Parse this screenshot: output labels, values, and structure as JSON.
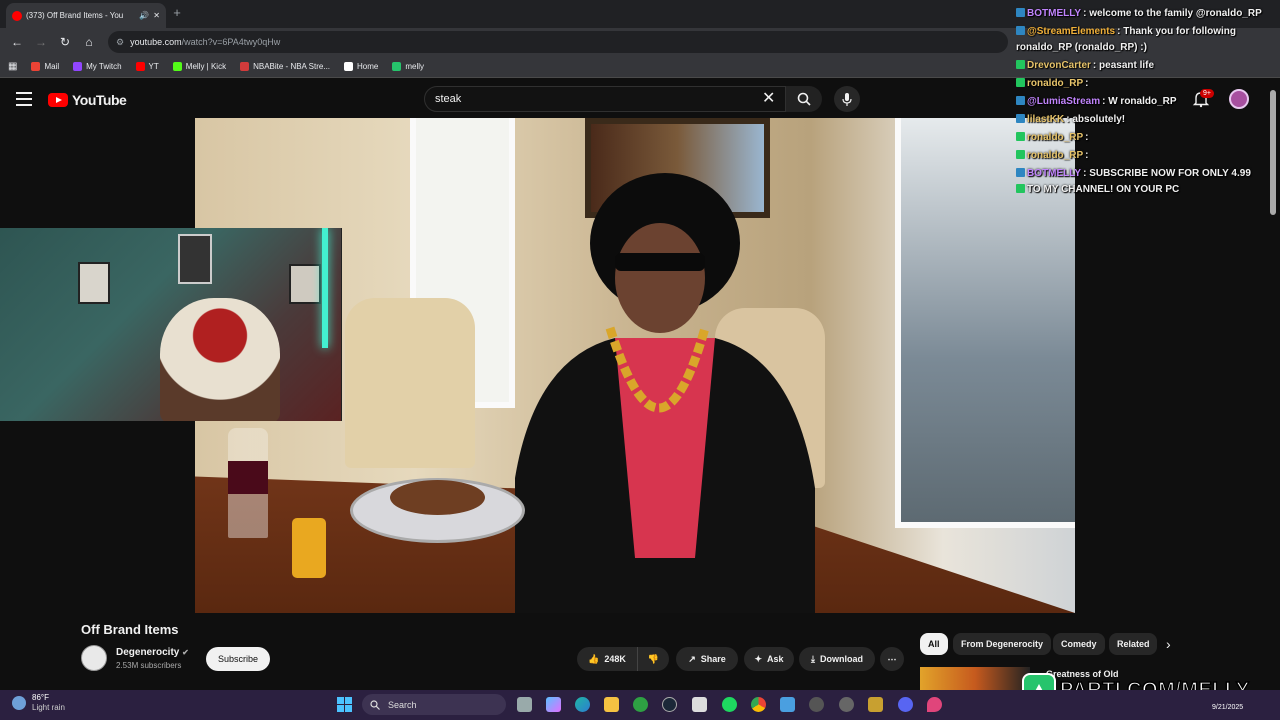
{
  "browser": {
    "tab_title": "(373) Off Brand Items - You",
    "url_host": "youtube.com",
    "url_path": "/watch?v=6PA4twy0qHw",
    "new_tab_glyph": "+",
    "bookmarks": [
      {
        "label": "Mail",
        "color": "#ea4335"
      },
      {
        "label": "My Twitch",
        "color": "#9146ff"
      },
      {
        "label": "YT",
        "color": "#ff0000"
      },
      {
        "label": "Melly | Kick",
        "color": "#53fc18"
      },
      {
        "label": "NBABite - NBA Stre...",
        "color": "#d23b3b"
      },
      {
        "label": "Home",
        "color": "#ffffff"
      },
      {
        "label": "melly",
        "color": "#26c46c"
      }
    ]
  },
  "youtube": {
    "logo_text": "YouTube",
    "search_query": "steak",
    "notification_count": "9+",
    "video_title": "Off Brand Items",
    "channel_name": "Degenerocity",
    "subscribers": "2.53M subscribers",
    "subscribe_label": "Subscribe",
    "actions": {
      "likes": "248K",
      "share": "Share",
      "ask": "Ask",
      "download": "Download"
    },
    "chips": [
      "All",
      "From Degenerocity",
      "Comedy",
      "Related"
    ],
    "next_video_title": "Greatness of Old"
  },
  "chat": [
    {
      "badge": "#2e86c1",
      "user": "BOTMELLY",
      "user_color": "#c084fc",
      "msg": "welcome to the family @ronaldo_RP"
    },
    {
      "badge": "#2e86c1",
      "user": "@StreamElements",
      "user_color": "#f0b03a",
      "msg": "Thank you for following"
    },
    {
      "badge": "",
      "user": "",
      "user_color": "#ffffff",
      "msg": "ronaldo_RP (ronaldo_RP) :)"
    },
    {
      "badge": "#22c55e",
      "user": "DrevonCarter",
      "user_color": "#e6c36a",
      "msg": "peasant life"
    },
    {
      "badge": "#22c55e",
      "user": "ronaldo_RP",
      "user_color": "#e6c36a",
      "msg": ""
    },
    {
      "badge": "#2e86c1",
      "user": "@LumiaStream",
      "user_color": "#c084fc",
      "msg": "W ronaldo_RP"
    },
    {
      "badge": "#2e86c1",
      "user": "lilastKK",
      "user_color": "#e6c36a",
      "msg": "absolutely!"
    },
    {
      "badge": "#22c55e",
      "user": "ronaldo_RP",
      "user_color": "#e6c36a",
      "msg": ""
    },
    {
      "badge": "#22c55e",
      "user": "ronaldo_RP",
      "user_color": "#e6c36a",
      "msg": ""
    },
    {
      "badge": "#2e86c1",
      "user": "BOTMELLY",
      "user_color": "#c084fc",
      "msg": "SUBSCRIBE NOW FOR ONLY 4.99"
    },
    {
      "badge": "#22c55e",
      "user": "",
      "user_color": "#ffffff",
      "msg": "TO MY CHANNEL! ON YOUR PC"
    }
  ],
  "watermark": "PARTI.COM/MELLY",
  "taskbar": {
    "temperature": "86°F",
    "weather": "Light rain",
    "search_label": "Search",
    "date": "9/21/2025"
  },
  "colors": {
    "yt_red": "#ff0000",
    "yt_bg": "#0f0f0f",
    "parti_green": "#26c46c",
    "taskbar_bg": "#2b2040"
  }
}
